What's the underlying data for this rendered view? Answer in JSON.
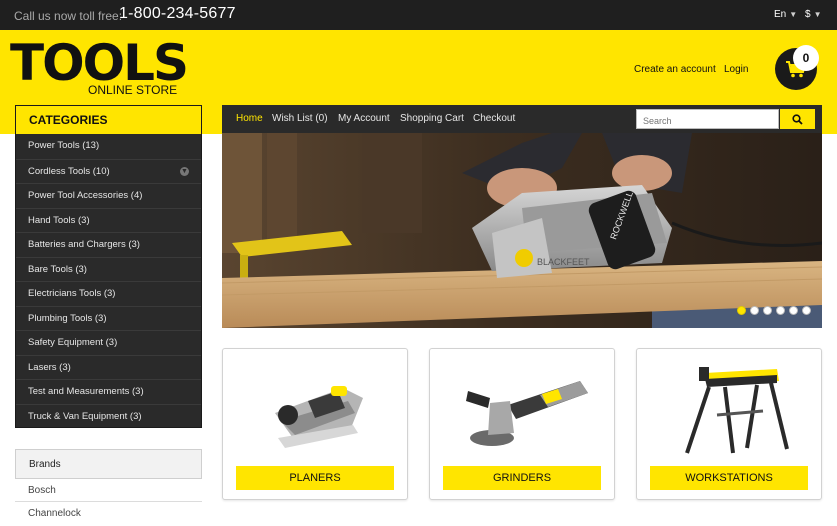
{
  "topbar": {
    "phone_label": "Call us now toll free:",
    "phone_number": "1-800-234-5677",
    "language": "En",
    "currency": "$"
  },
  "header": {
    "logo_title": "TOOLS",
    "logo_subtitle": "ONLINE STORE",
    "create_account": "Create an account",
    "login": "Login",
    "cart_count": "0"
  },
  "colors": {
    "accent": "#ffe500",
    "dark": "#2a2a2a",
    "topbar": "#1f1f1f"
  },
  "sidebar": {
    "categories_title": "CATEGORIES",
    "categories": [
      {
        "label": "Power Tools (13)"
      },
      {
        "label": "Cordless Tools (10)"
      },
      {
        "label": "Power Tool Accessories (4)"
      },
      {
        "label": "Hand Tools (3)"
      },
      {
        "label": "Batteries and Chargers (3)"
      },
      {
        "label": "Bare Tools (3)"
      },
      {
        "label": "Electricians Tools (3)"
      },
      {
        "label": "Plumbing Tools (3)"
      },
      {
        "label": "Safety Equipment (3)"
      },
      {
        "label": "Lasers (3)"
      },
      {
        "label": "Test and Measurements (3)"
      },
      {
        "label": "Truck & Van Equipment (3)"
      }
    ],
    "brands_title": "Brands",
    "brands": [
      "Bosch",
      "Channelock"
    ]
  },
  "nav": {
    "items": [
      "Home",
      "Wish List (0)",
      "My Account",
      "Shopping Cart",
      "Checkout"
    ],
    "search_placeholder": "Search"
  },
  "hero": {
    "brand_text": "ROCKWELL",
    "model_text": "BLACKFEET",
    "slide_count": 6,
    "active_slide": 1
  },
  "products": [
    {
      "label": "PLANERS",
      "icon": "planer-icon"
    },
    {
      "label": "GRINDERS",
      "icon": "grinder-icon"
    },
    {
      "label": "WORKSTATIONS",
      "icon": "workstation-icon"
    }
  ]
}
